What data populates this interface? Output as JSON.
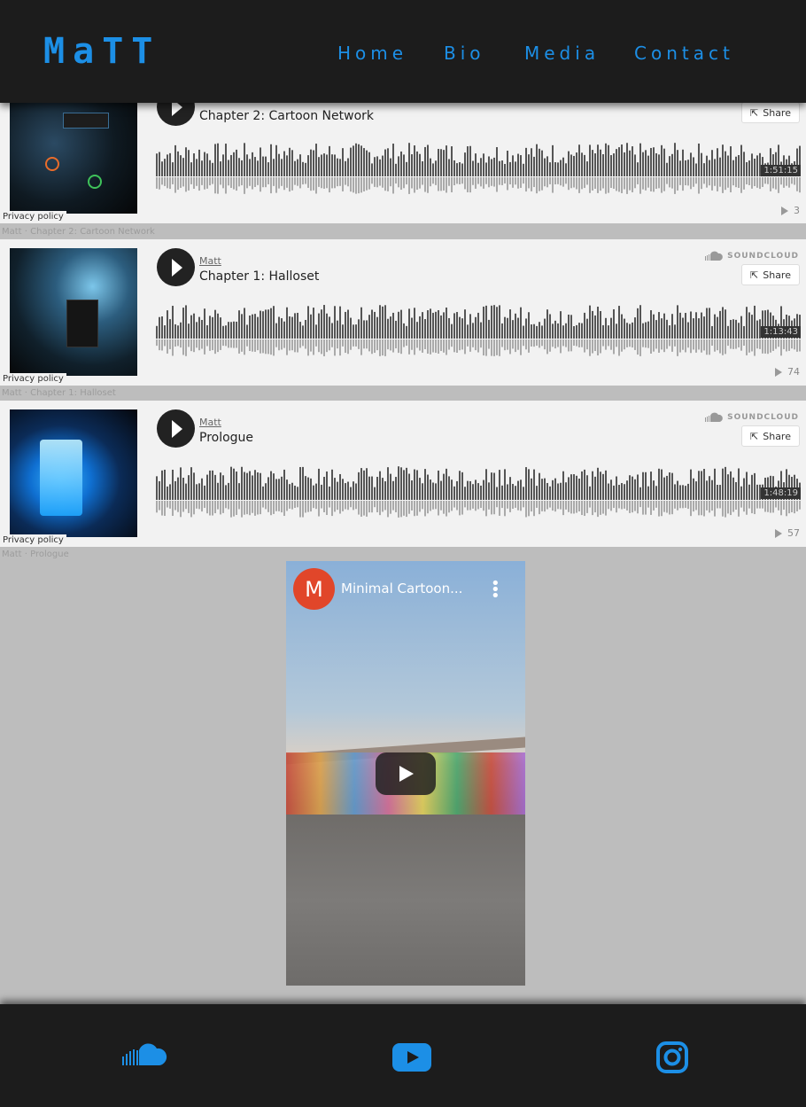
{
  "header": {
    "logo": [
      "M",
      "a",
      "T",
      "T"
    ],
    "nav": [
      {
        "label": "Home"
      },
      {
        "label": "Bio"
      },
      {
        "label": "Media"
      },
      {
        "label": "Contact"
      }
    ]
  },
  "tracks": [
    {
      "artist": "",
      "title": "Chapter 2: Cartoon Network",
      "duration": "1:51:15",
      "plays": "3",
      "privacy": "Privacy policy",
      "share": "Share",
      "brand": "",
      "ghost": "Matt · Chapter 2: Cartoon Network"
    },
    {
      "artist": "Matt",
      "title": "Chapter 1: Halloset",
      "duration": "1:13:43",
      "plays": "74",
      "privacy": "Privacy policy",
      "share": "Share",
      "brand": "SOUNDCLOUD",
      "ghost": "Matt · Chapter 1: Halloset"
    },
    {
      "artist": "Matt",
      "title": "Prologue",
      "duration": "1:48:19",
      "plays": "57",
      "privacy": "Privacy policy",
      "share": "Share",
      "brand": "SOUNDCLOUD",
      "ghost": "Matt · Prologue"
    }
  ],
  "video": {
    "channel_initial": "M",
    "title": "Minimal Cartoon..."
  },
  "footer": {
    "icons": [
      "soundcloud-icon",
      "youtube-icon",
      "instagram-icon"
    ]
  },
  "colors": {
    "accent": "#1c8fe6",
    "header_bg": "#1c1c1c",
    "page_bg": "#bdbdbd",
    "player_bg": "#f2f2f2"
  }
}
